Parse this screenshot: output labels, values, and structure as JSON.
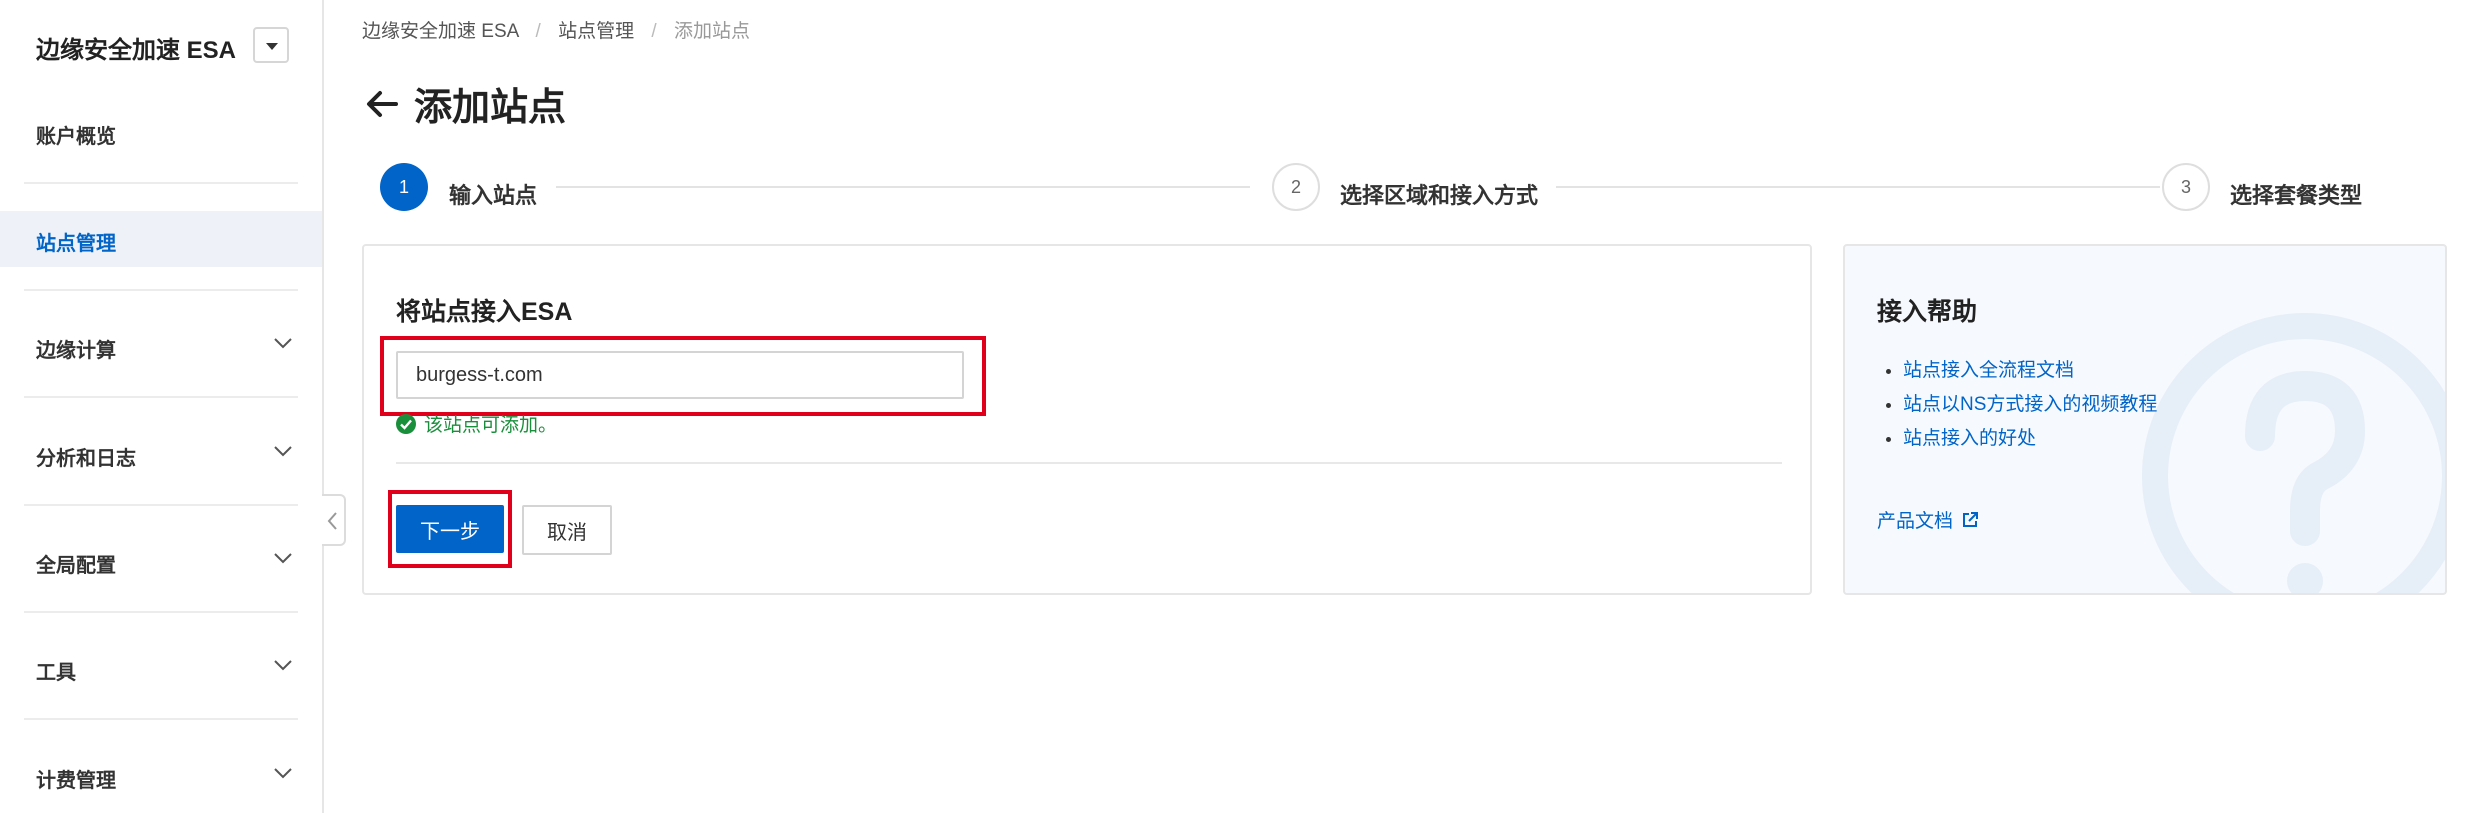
{
  "sidebar": {
    "app_title": "边缘安全加速 ESA",
    "items": [
      {
        "label": "账户概览",
        "active": false,
        "expandable": false
      },
      {
        "label": "站点管理",
        "active": true,
        "expandable": false
      },
      {
        "label": "边缘计算",
        "active": false,
        "expandable": true
      },
      {
        "label": "分析和日志",
        "active": false,
        "expandable": true
      },
      {
        "label": "全局配置",
        "active": false,
        "expandable": true
      },
      {
        "label": "工具",
        "active": false,
        "expandable": true
      },
      {
        "label": "计费管理",
        "active": false,
        "expandable": true
      }
    ]
  },
  "breadcrumb": {
    "items": [
      "边缘安全加速 ESA",
      "站点管理",
      "添加站点"
    ],
    "separator": "/"
  },
  "page_title": "添加站点",
  "steps": [
    {
      "number": "1",
      "label": "输入站点",
      "active": true
    },
    {
      "number": "2",
      "label": "选择区域和接入方式",
      "active": false
    },
    {
      "number": "3",
      "label": "选择套餐类型",
      "active": false
    }
  ],
  "form": {
    "title": "将站点接入ESA",
    "site_value": "burgess-t.com",
    "success_message": "该站点可添加。",
    "next_label": "下一步",
    "cancel_label": "取消"
  },
  "help": {
    "title": "接入帮助",
    "links": [
      "站点接入全流程文档",
      "站点以NS方式接入的视频教程",
      "站点接入的好处"
    ],
    "doc_link": "产品文档"
  },
  "colors": {
    "primary": "#0064c8",
    "success": "#1a8f3b",
    "highlight": "#e0001b",
    "active_nav_bg": "#eef2f8"
  },
  "icons": {
    "back": "arrow-left-icon",
    "success": "check-circle-icon",
    "external": "external-link-icon",
    "chevron": "chevron-down-icon",
    "help_decoration": "question-icon"
  }
}
